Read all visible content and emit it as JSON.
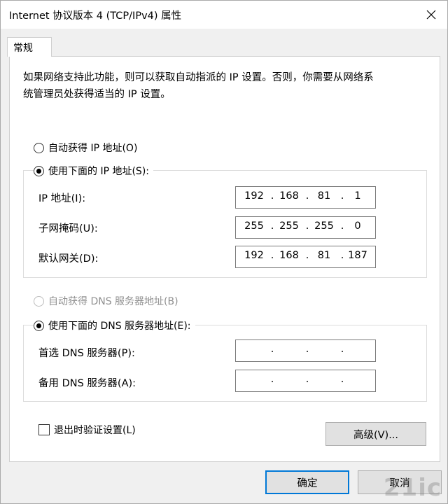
{
  "window": {
    "title": "Internet 协议版本 4 (TCP/IPv4) 属性",
    "close_icon": "close-icon"
  },
  "tabs": [
    {
      "label": "常规",
      "selected": true
    }
  ],
  "description": "如果网络支持此功能，则可以获取自动指派的 IP 设置。否则，你需要从网络系\n统管理员处获得适当的 IP 设置。",
  "ip_section": {
    "auto_option": {
      "label": "自动获得 IP 地址(O)",
      "checked": false
    },
    "manual_option": {
      "label": "使用下面的 IP 地址(S):",
      "checked": true
    },
    "fields": [
      {
        "label": "IP 地址(I):",
        "octets": [
          "192",
          "168",
          "81",
          "1"
        ]
      },
      {
        "label": "子网掩码(U):",
        "octets": [
          "255",
          "255",
          "255",
          "0"
        ]
      },
      {
        "label": "默认网关(D):",
        "octets": [
          "192",
          "168",
          "81",
          "187"
        ]
      }
    ]
  },
  "dns_section": {
    "auto_option": {
      "label": "自动获得 DNS 服务器地址(B)",
      "checked": false,
      "disabled": true
    },
    "manual_option": {
      "label": "使用下面的 DNS 服务器地址(E):",
      "checked": true
    },
    "fields": [
      {
        "label": "首选 DNS 服务器(P):",
        "octets": [
          "",
          "",
          "",
          ""
        ]
      },
      {
        "label": "备用 DNS 服务器(A):",
        "octets": [
          "",
          "",
          "",
          ""
        ]
      }
    ]
  },
  "validate_checkbox": {
    "label": "退出时验证设置(L)",
    "checked": false
  },
  "buttons": {
    "advanced": "高级(V)...",
    "ok": "确定",
    "cancel": "取消"
  },
  "watermark": "21ic"
}
